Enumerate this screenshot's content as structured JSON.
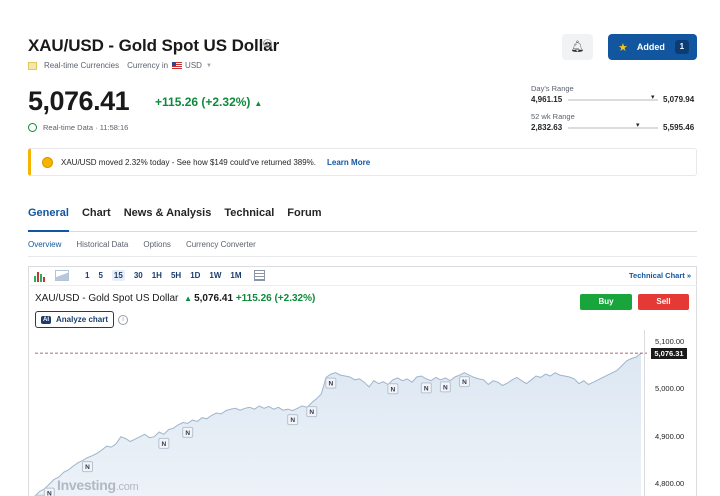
{
  "header": {
    "title": "XAU/USD - Gold Spot US Dollar",
    "category": "Real-time Currencies",
    "currency_label": "Currency in",
    "currency": "USD",
    "added_label": "Added",
    "added_count": "1"
  },
  "quote": {
    "price": "5,076.41",
    "change": "+115.26 (+2.32%)",
    "realtime_label": "Real-time Data",
    "time": "11:58:16"
  },
  "ranges": {
    "day": {
      "label": "Day's Range",
      "low": "4,961.15",
      "high": "5,079.94"
    },
    "week52": {
      "label": "52 wk Range",
      "low": "2,832.63",
      "high": "5,595.46"
    }
  },
  "banner": {
    "text": "XAU/USD moved 2.32% today - See how $149 could've returned 389%.",
    "link": "Learn More"
  },
  "tabs": [
    "General",
    "Chart",
    "News & Analysis",
    "Technical",
    "Forum"
  ],
  "subtabs": [
    "Overview",
    "Historical Data",
    "Options",
    "Currency Converter"
  ],
  "toolbar": {
    "intervals": [
      "1",
      "5",
      "15",
      "30",
      "1H",
      "5H",
      "1D",
      "1W",
      "1M"
    ],
    "active_interval": "15",
    "technical_chart": "Technical Chart »"
  },
  "chart_header": {
    "name": "XAU/USD - Gold Spot US Dollar",
    "price": "5,076.41",
    "change": "+115.26",
    "change_pct": "(+2.32%)",
    "buy_label": "Buy",
    "sell_label": "Sell",
    "analyze_label": "Analyze chart",
    "ai_badge": "AI"
  },
  "watermark": {
    "main": "Investing",
    "suffix": ".com"
  },
  "news_marker": "N",
  "colors": {
    "accent": "#1256a0",
    "up": "#0e8a3c",
    "buy": "#17a53c",
    "sell": "#e53935",
    "area": "#dce7f2"
  },
  "chart_data": {
    "type": "area",
    "title": "XAU/USD - Gold Spot US Dollar",
    "ylim": [
      4775,
      5125
    ],
    "yticks": [
      "5,100.00",
      "5,000.00",
      "4,900.00",
      "4,800.00"
    ],
    "ytick_values": [
      5100,
      5000,
      4900,
      4800
    ],
    "last_price": 5076.31,
    "last_price_label": "5,076.31",
    "series": [
      {
        "values": [
          4775,
          4785,
          4790,
          4800,
          4810,
          4815,
          4825,
          4830,
          4838,
          4845,
          4850,
          4856,
          4860,
          4865,
          4872,
          4880,
          4878,
          4885,
          4900,
          4896,
          4890,
          4895,
          4900,
          4905,
          4898,
          4900,
          4910,
          4905,
          4915,
          4918,
          4925,
          4930,
          4928,
          4935,
          4932,
          4940,
          4938,
          4945,
          4950,
          4948,
          4955,
          4958,
          4960,
          4956,
          4960,
          4962,
          4958,
          4965,
          4960,
          4964,
          4958,
          4962,
          4956,
          4958,
          4955,
          4960,
          4965,
          4962,
          4972,
          4980,
          4990,
          5025,
          5032,
          5035,
          5030,
          5028,
          5026,
          5020,
          5022,
          5015,
          5005,
          5018,
          5012,
          5016,
          5010,
          5020,
          5024,
          5018,
          5022,
          5015,
          5026,
          5028,
          5022,
          5018,
          5025,
          5020,
          5024,
          5018,
          5026,
          5030,
          5035,
          5030,
          5025,
          5022,
          5020,
          5010,
          5018,
          5015,
          5008,
          5013,
          5020,
          5025,
          5018,
          5012,
          5020,
          5028,
          5025,
          5032,
          5028,
          5035,
          5030,
          5028,
          5026,
          5022,
          5012,
          5018,
          5010,
          5015,
          5020,
          5025,
          5030,
          5035,
          5040,
          5050,
          5060,
          5065,
          5068,
          5076.31
        ]
      }
    ],
    "news_marker_indices": [
      1,
      3,
      11,
      27,
      32,
      54,
      58,
      62,
      75,
      82,
      86,
      90
    ]
  }
}
